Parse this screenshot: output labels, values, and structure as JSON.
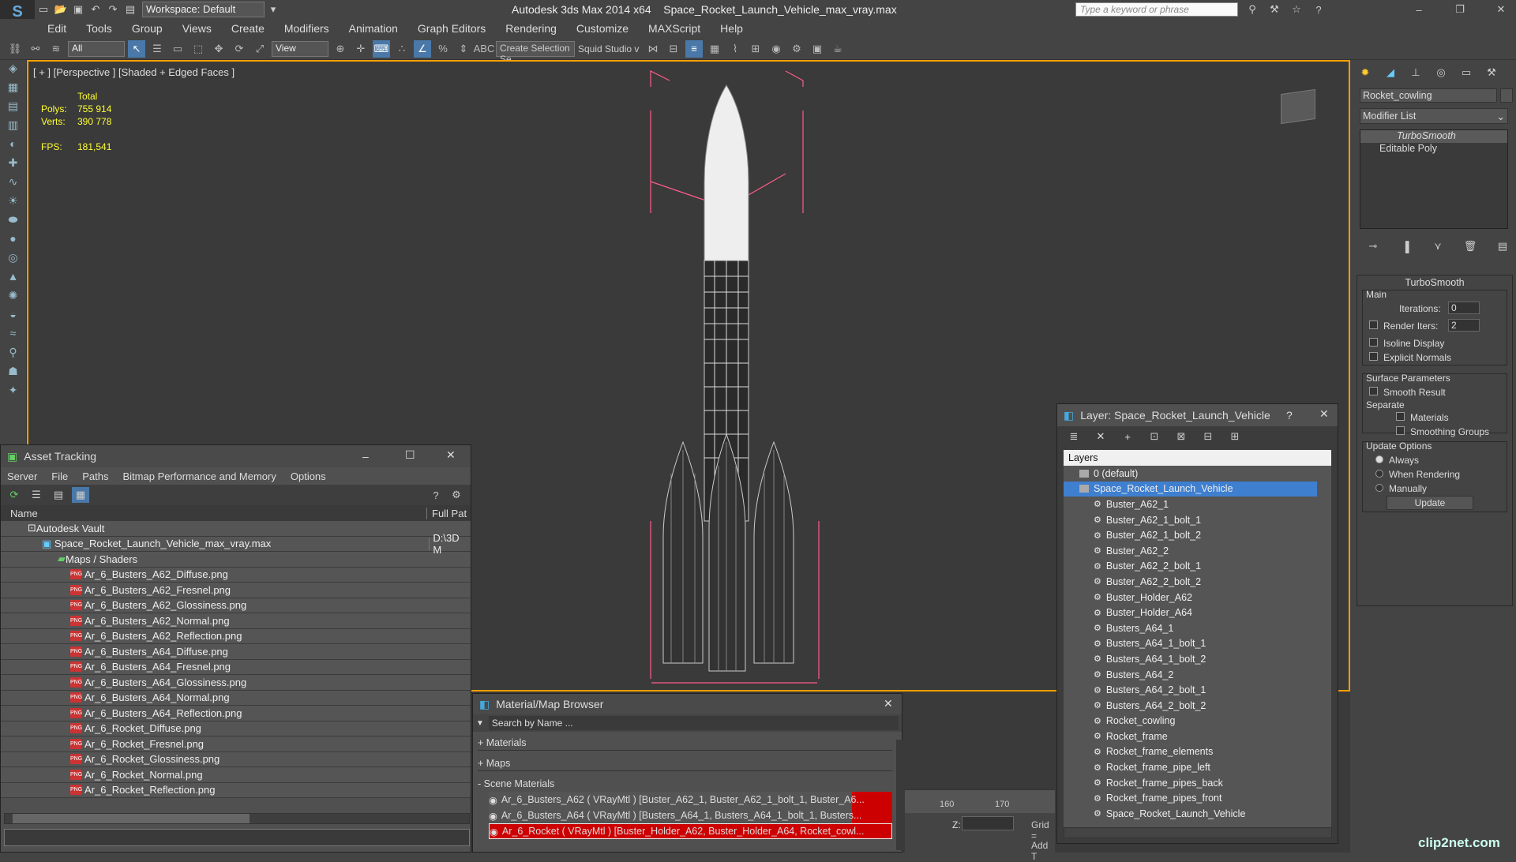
{
  "window": {
    "app_title": "Autodesk 3ds Max  2014 x64",
    "file_title": "Space_Rocket_Launch_Vehicle_max_vray.max",
    "workspace": "Workspace: Default",
    "search_placeholder": "Type a keyword or phrase"
  },
  "menu": [
    "Edit",
    "Tools",
    "Group",
    "Views",
    "Create",
    "Modifiers",
    "Animation",
    "Graph Editors",
    "Rendering",
    "Customize",
    "MAXScript",
    "Help"
  ],
  "toolbar": {
    "filter": "All",
    "view": "View",
    "selection_set": "Create Selection Se",
    "studio": "Squid Studio v"
  },
  "viewport": {
    "label": "[ + ] [Perspective ] [Shaded + Edged Faces ]",
    "total": "Total",
    "polys_label": "Polys:",
    "polys": "755 914",
    "verts_label": "Verts:",
    "verts": "390 778",
    "fps_label": "FPS:",
    "fps": "181,541"
  },
  "timeline": {
    "ticks": [
      "160",
      "170"
    ],
    "z_label": "Z:",
    "grid": "Grid =",
    "add": "Add T"
  },
  "command_panel": {
    "object_name": "Rocket_cowling",
    "modifier_list": "Modifier List",
    "stack": [
      "TurboSmooth",
      "Editable Poly"
    ],
    "rollout_title": "TurboSmooth",
    "main_label": "Main",
    "iterations_label": "Iterations:",
    "iterations": "0",
    "render_iters_label": "Render Iters:",
    "render_iters": "2",
    "isoline": "Isoline Display",
    "explicit": "Explicit Normals",
    "surface_params": "Surface Parameters",
    "smooth_result": "Smooth Result",
    "separate": "Separate",
    "materials": "Materials",
    "smoothing_groups": "Smoothing Groups",
    "update_options": "Update Options",
    "always": "Always",
    "when_rendering": "When Rendering",
    "manually": "Manually",
    "update_button": "Update"
  },
  "asset_tracking": {
    "title": "Asset Tracking",
    "menu": [
      "Server",
      "File",
      "Paths",
      "Bitmap Performance and Memory",
      "Options"
    ],
    "col_name": "Name",
    "col_path": "Full Pat",
    "vault": "Autodesk Vault",
    "file": "Space_Rocket_Launch_Vehicle_max_vray.max",
    "file_path": "D:\\3D M",
    "maps_folder": "Maps / Shaders",
    "maps": [
      "Ar_6_Busters_A62_Diffuse.png",
      "Ar_6_Busters_A62_Fresnel.png",
      "Ar_6_Busters_A62_Glossiness.png",
      "Ar_6_Busters_A62_Normal.png",
      "Ar_6_Busters_A62_Reflection.png",
      "Ar_6_Busters_A64_Diffuse.png",
      "Ar_6_Busters_A64_Fresnel.png",
      "Ar_6_Busters_A64_Glossiness.png",
      "Ar_6_Busters_A64_Normal.png",
      "Ar_6_Busters_A64_Reflection.png",
      "Ar_6_Rocket_Diffuse.png",
      "Ar_6_Rocket_Fresnel.png",
      "Ar_6_Rocket_Glossiness.png",
      "Ar_6_Rocket_Normal.png",
      "Ar_6_Rocket_Reflection.png"
    ]
  },
  "material_browser": {
    "title": "Material/Map Browser",
    "search": "Search by Name ...",
    "sections": [
      "+ Materials",
      "+ Maps",
      "- Scene Materials"
    ],
    "materials": [
      "Ar_6_Busters_A62  ( VRayMtl ) [Buster_A62_1, Buster_A62_1_bolt_1, Buster_A6...",
      "Ar_6_Busters_A64  ( VRayMtl ) [Busters_A64_1, Busters_A64_1_bolt_1, Busters...",
      "Ar_6_Rocket  ( VRayMtl ) [Buster_Holder_A62, Buster_Holder_A64, Rocket_cowl..."
    ]
  },
  "layer_window": {
    "title": "Layer: Space_Rocket_Launch_Vehicle",
    "help": "?",
    "header": "Layers",
    "default_layer": "0 (default)",
    "active_layer": "Space_Rocket_Launch_Vehicle",
    "objects": [
      "Buster_A62_1",
      "Buster_A62_1_bolt_1",
      "Buster_A62_1_bolt_2",
      "Buster_A62_2",
      "Buster_A62_2_bolt_1",
      "Buster_A62_2_bolt_2",
      "Buster_Holder_A62",
      "Buster_Holder_A64",
      "Busters_A64_1",
      "Busters_A64_1_bolt_1",
      "Busters_A64_1_bolt_2",
      "Busters_A64_2",
      "Busters_A64_2_bolt_1",
      "Busters_A64_2_bolt_2",
      "Rocket_cowling",
      "Rocket_frame",
      "Rocket_frame_elements",
      "Rocket_frame_pipe_left",
      "Rocket_frame_pipes_back",
      "Rocket_frame_pipes_front",
      "Space_Rocket_Launch_Vehicle"
    ]
  },
  "watermark": "clip2net.com"
}
